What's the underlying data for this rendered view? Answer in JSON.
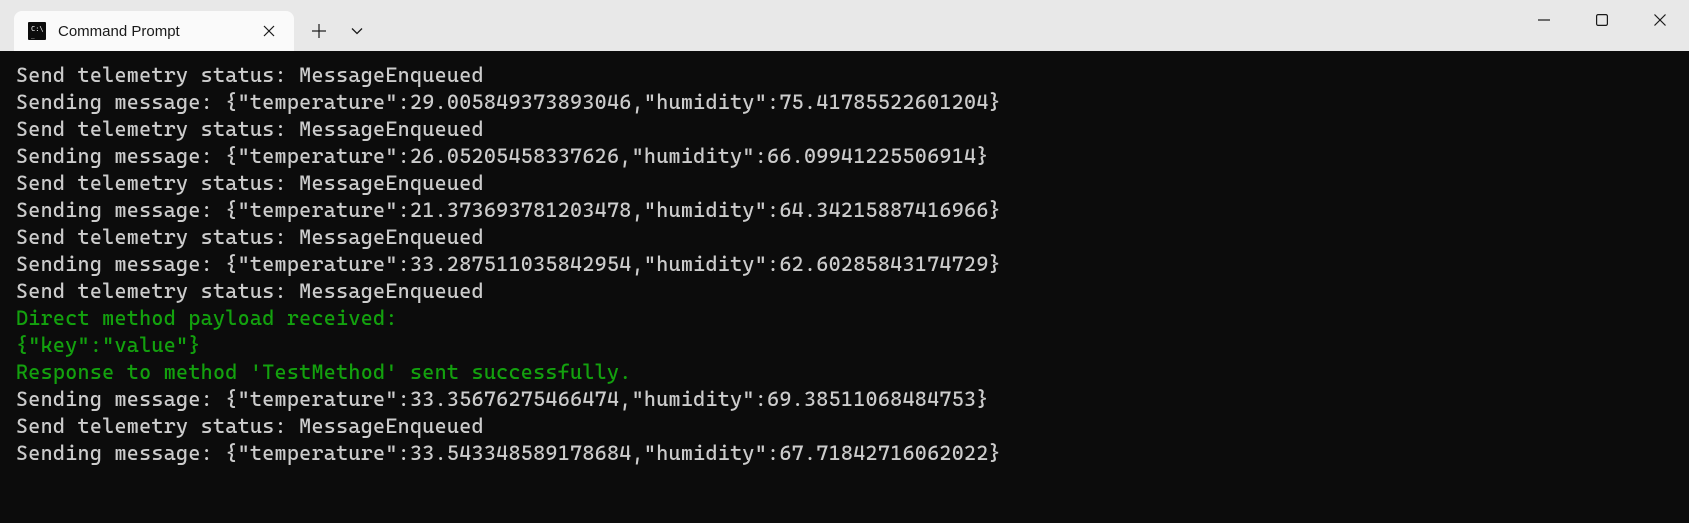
{
  "titlebar": {
    "tab": {
      "title": "Command Prompt"
    }
  },
  "terminal": {
    "lines": [
      {
        "color": "default",
        "text": "Send telemetry status: MessageEnqueued"
      },
      {
        "color": "default",
        "text": "Sending message: {\"temperature\":29.005849373893046,\"humidity\":75.41785522601204}"
      },
      {
        "color": "default",
        "text": "Send telemetry status: MessageEnqueued"
      },
      {
        "color": "default",
        "text": "Sending message: {\"temperature\":26.05205458337626,\"humidity\":66.09941225506914}"
      },
      {
        "color": "default",
        "text": "Send telemetry status: MessageEnqueued"
      },
      {
        "color": "default",
        "text": "Sending message: {\"temperature\":21.373693781203478,\"humidity\":64.34215887416966}"
      },
      {
        "color": "default",
        "text": "Send telemetry status: MessageEnqueued"
      },
      {
        "color": "default",
        "text": "Sending message: {\"temperature\":33.287511035842954,\"humidity\":62.60285843174729}"
      },
      {
        "color": "default",
        "text": "Send telemetry status: MessageEnqueued"
      },
      {
        "color": "green",
        "text": "Direct method payload received:"
      },
      {
        "color": "green",
        "text": "{\"key\":\"value\"}"
      },
      {
        "color": "green",
        "text": "Response to method 'TestMethod' sent successfully."
      },
      {
        "color": "default",
        "text": "Sending message: {\"temperature\":33.35676275466474,\"humidity\":69.38511068484753}"
      },
      {
        "color": "default",
        "text": "Send telemetry status: MessageEnqueued"
      },
      {
        "color": "default",
        "text": "Sending message: {\"temperature\":33.543348589178684,\"humidity\":67.71842716062022}"
      }
    ]
  }
}
